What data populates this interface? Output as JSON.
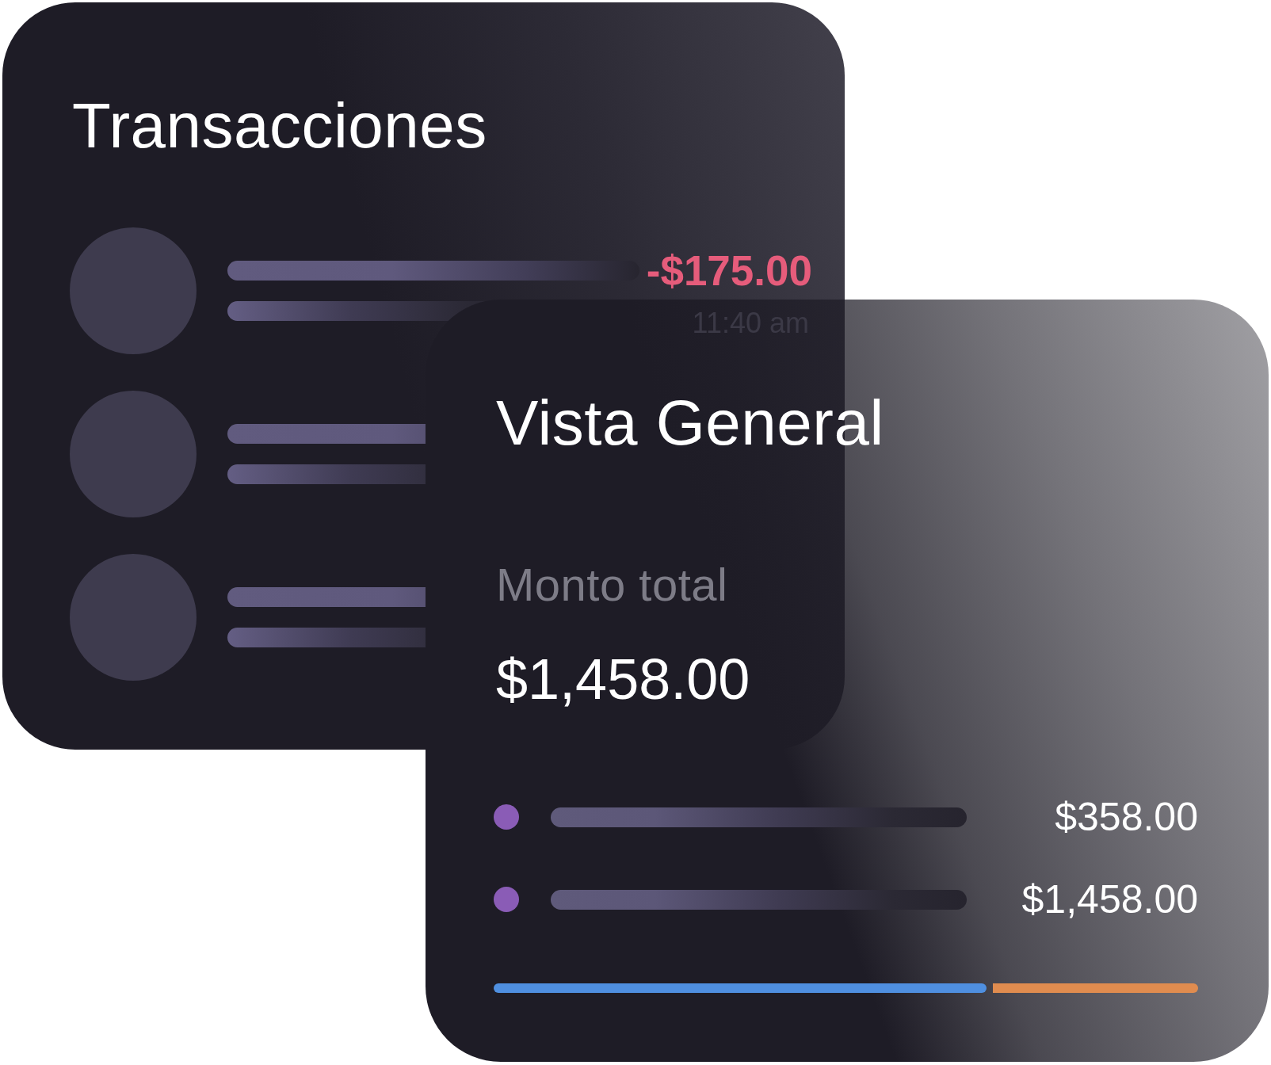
{
  "transactions": {
    "title": "Transacciones",
    "rows": [
      {
        "kind": "detailed",
        "amount": "-$175.00",
        "time": "11:40 am"
      },
      {
        "kind": "plain"
      },
      {
        "kind": "plain"
      }
    ]
  },
  "overview": {
    "title": "Vista General",
    "total_label": "Monto total",
    "total_amount": "$1,458.00",
    "legend": [
      {
        "amount": "$358.00"
      },
      {
        "amount": "$1,458.00"
      }
    ],
    "split_bar": {
      "level": 0.7
    }
  }
}
